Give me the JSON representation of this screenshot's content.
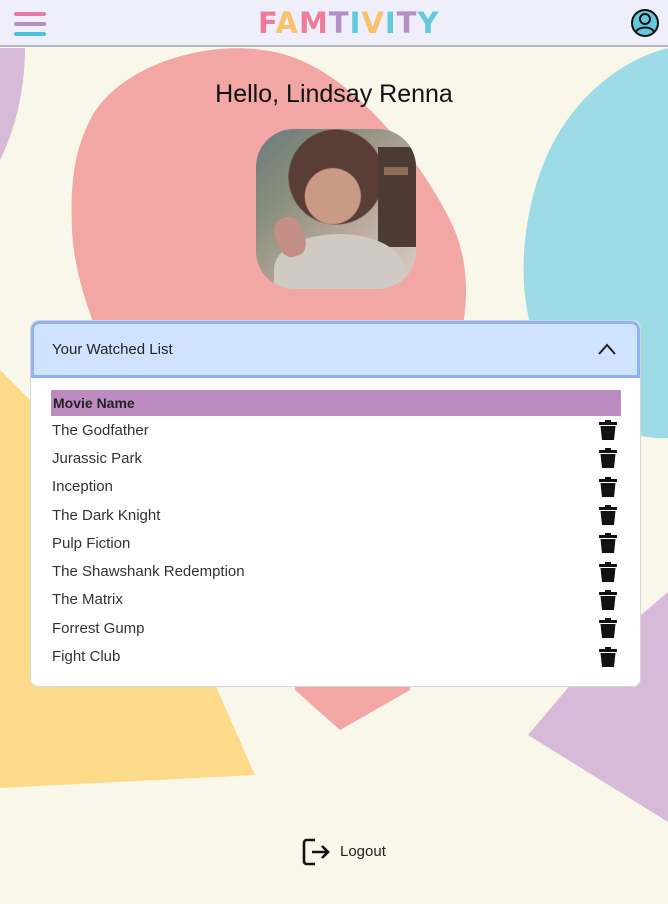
{
  "header": {
    "logo_text": "FAMTIVITY",
    "menu_icon": "hamburger-icon",
    "profile_icon": "user-circle-icon"
  },
  "profile": {
    "greeting": "Hello, Lindsay Renna",
    "avatar_alt": "profile photo"
  },
  "watched_list": {
    "title": "Your Watched List",
    "expanded": true,
    "column_header": "Movie Name",
    "delete_icon": "trash-icon",
    "movies": [
      "The Godfather",
      "Jurassic Park",
      "Inception",
      "The Dark Knight",
      "Pulp Fiction",
      "The Shawshank Redemption",
      "The Matrix",
      "Forrest Gump",
      "Fight Club"
    ]
  },
  "footer": {
    "logout_label": "Logout",
    "logout_icon": "logout-icon"
  },
  "colors": {
    "background": "#f9f7ea",
    "navbar": "#efeefb",
    "table_header": "#bc8cc0",
    "accordion_header": "#cfe2ff",
    "shape_pink": "#f2a7a4",
    "shape_blue": "#9ddbe6",
    "shape_yellow": "#fdda8a",
    "shape_purple": "#d6bad8"
  }
}
